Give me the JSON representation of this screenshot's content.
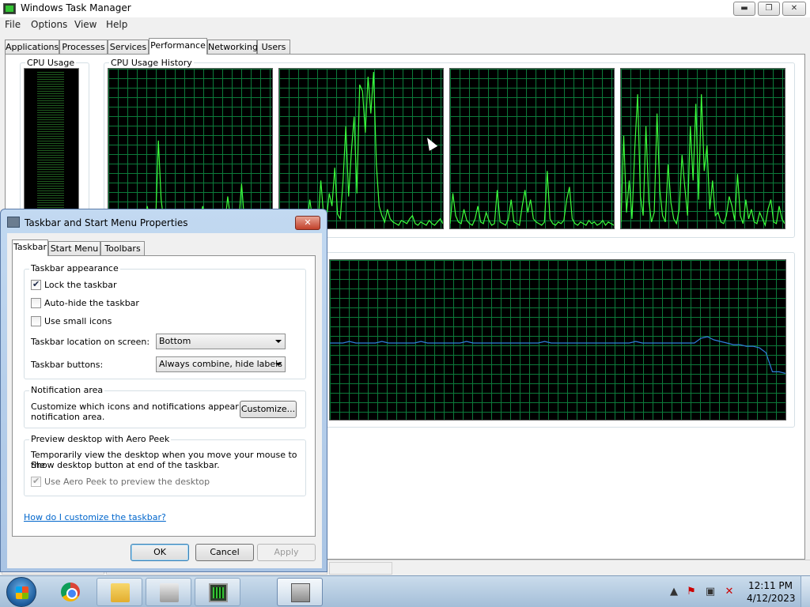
{
  "task_manager": {
    "title": "Windows Task Manager",
    "menu": [
      "File",
      "Options",
      "View",
      "Help"
    ],
    "tabs": [
      "Applications",
      "Processes",
      "Services",
      "Performance",
      "Networking",
      "Users"
    ],
    "active_tab": "Performance",
    "cpu_usage_label": "CPU Usage",
    "cpu_history_label": "CPU Usage History",
    "window_controls": {
      "minimize": "▬",
      "maximize": "❐",
      "close": "✕"
    }
  },
  "dialog": {
    "title": "Taskbar and Start Menu Properties",
    "close_glyph": "✕",
    "tabs": [
      "Taskbar",
      "Start Menu",
      "Toolbars"
    ],
    "active_tab": "Taskbar",
    "appearance": {
      "label": "Taskbar appearance",
      "lock": {
        "label": "Lock the taskbar",
        "checked": true
      },
      "autohide": {
        "label": "Auto-hide the taskbar",
        "checked": false
      },
      "small_icons": {
        "label": "Use small icons",
        "checked": false
      },
      "location_label": "Taskbar location on screen:",
      "location_value": "Bottom",
      "buttons_label": "Taskbar buttons:",
      "buttons_value": "Always combine, hide labels"
    },
    "notification": {
      "label": "Notification area",
      "text_line1": "Customize which icons and notifications appear in the",
      "text_line2": "notification area.",
      "customize_button": "Customize..."
    },
    "aero_peek": {
      "label": "Preview desktop with Aero Peek",
      "text_line1": "Temporarily view the desktop when you move your mouse to the",
      "text_line2": "Show desktop button at end of the taskbar.",
      "checkbox_label": "Use Aero Peek to preview the desktop",
      "checked": true,
      "disabled": true
    },
    "help_link": "How do I customize the taskbar?",
    "buttons": {
      "ok": "OK",
      "cancel": "Cancel",
      "apply": "Apply"
    }
  },
  "taskbar": {
    "clock_time": "12:11 PM",
    "clock_date": "4/12/2023",
    "tray_icons": [
      "show-hidden-icons",
      "action-center-icon",
      "network-icon",
      "volume-muted-icon"
    ]
  },
  "chart_data": [
    {
      "type": "line",
      "series": [
        {
          "values": [
            2,
            3,
            2,
            4,
            3,
            2,
            5,
            3,
            2,
            3,
            6,
            4,
            2,
            3,
            14,
            6,
            3,
            2,
            55,
            18,
            4,
            3,
            8,
            3,
            2,
            4,
            12,
            5,
            3,
            2,
            4,
            3,
            2,
            6,
            14,
            4,
            3,
            2,
            5,
            3,
            2,
            4,
            3,
            20,
            6,
            3,
            2,
            4,
            28,
            5,
            3,
            2,
            4,
            3,
            2,
            3,
            4,
            2,
            3,
            2
          ]
        }
      ],
      "ylim": [
        0,
        100
      ]
    },
    {
      "type": "line",
      "series": [
        {
          "values": [
            6,
            4,
            3,
            2,
            8,
            4,
            3,
            12,
            5,
            3,
            2,
            18,
            6,
            4,
            3,
            30,
            8,
            5,
            22,
            14,
            38,
            9,
            6,
            30,
            64,
            20,
            48,
            70,
            22,
            90,
            86,
            60,
            95,
            72,
            98,
            40,
            14,
            8,
            4,
            12,
            6,
            4,
            3,
            2,
            5,
            4,
            3,
            6,
            8,
            3,
            2,
            4,
            3,
            2,
            5,
            3,
            2,
            4,
            6,
            3
          ]
        }
      ],
      "ylim": [
        0,
        100
      ]
    },
    {
      "type": "line",
      "series": [
        {
          "values": [
            3,
            22,
            8,
            4,
            3,
            12,
            5,
            3,
            2,
            6,
            14,
            4,
            3,
            10,
            5,
            2,
            3,
            24,
            4,
            3,
            2,
            6,
            18,
            4,
            3,
            2,
            14,
            24,
            10,
            18,
            6,
            4,
            3,
            2,
            4,
            36,
            6,
            3,
            2,
            4,
            3,
            5,
            18,
            26,
            6,
            3,
            2,
            4,
            3,
            2,
            5,
            3,
            4,
            2,
            3,
            5,
            2,
            4,
            3,
            2
          ]
        }
      ],
      "ylim": [
        0,
        100
      ]
    },
    {
      "type": "line",
      "series": [
        {
          "values": [
            4,
            58,
            10,
            30,
            6,
            50,
            84,
            20,
            8,
            64,
            18,
            4,
            10,
            72,
            24,
            8,
            4,
            40,
            16,
            6,
            3,
            12,
            46,
            26,
            8,
            64,
            30,
            78,
            18,
            84,
            36,
            52,
            12,
            30,
            8,
            10,
            4,
            3,
            8,
            20,
            14,
            5,
            34,
            8,
            3,
            18,
            6,
            12,
            4,
            3,
            10,
            6,
            2,
            12,
            18,
            4,
            3,
            14,
            6,
            3
          ]
        }
      ],
      "ylim": [
        0,
        100
      ]
    },
    {
      "type": "line",
      "series": [
        {
          "values": [
            48,
            48,
            48,
            49,
            48,
            48,
            48,
            48,
            49,
            48,
            48,
            48,
            48,
            48,
            49,
            48,
            48,
            48,
            48,
            48,
            48,
            49,
            48,
            48,
            48,
            48,
            48,
            48,
            48,
            48,
            48,
            48,
            48,
            49,
            48,
            48,
            48,
            48,
            48,
            48,
            48,
            48,
            48,
            48,
            48,
            48,
            48,
            49,
            48,
            48,
            48,
            48,
            48,
            48,
            48,
            48,
            48,
            51,
            52,
            50,
            49,
            48,
            47,
            47,
            46,
            46,
            45,
            42,
            30,
            30,
            29
          ]
        }
      ],
      "ylim": [
        0,
        100
      ]
    }
  ]
}
